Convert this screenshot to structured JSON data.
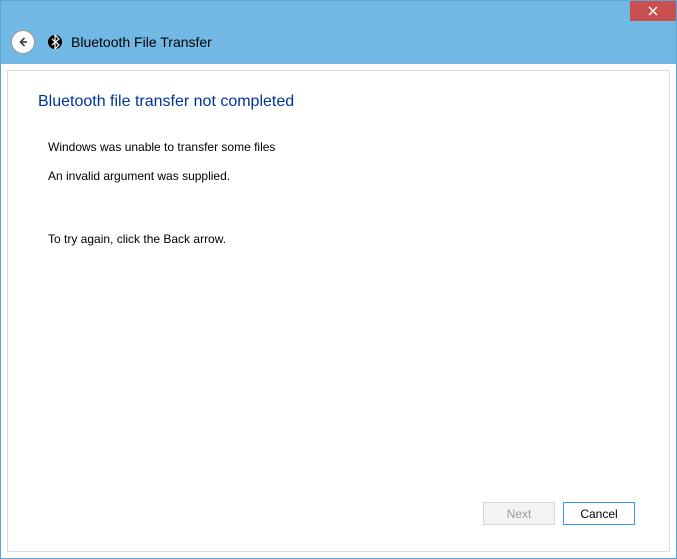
{
  "titlebar": {
    "window_title": "Bluetooth File Transfer"
  },
  "content": {
    "heading": "Bluetooth file transfer not completed",
    "message_primary": "Windows was unable to transfer some files",
    "message_error": "An invalid argument was supplied.",
    "message_hint": "To try again, click the Back arrow."
  },
  "buttons": {
    "next": "Next",
    "cancel": "Cancel"
  }
}
